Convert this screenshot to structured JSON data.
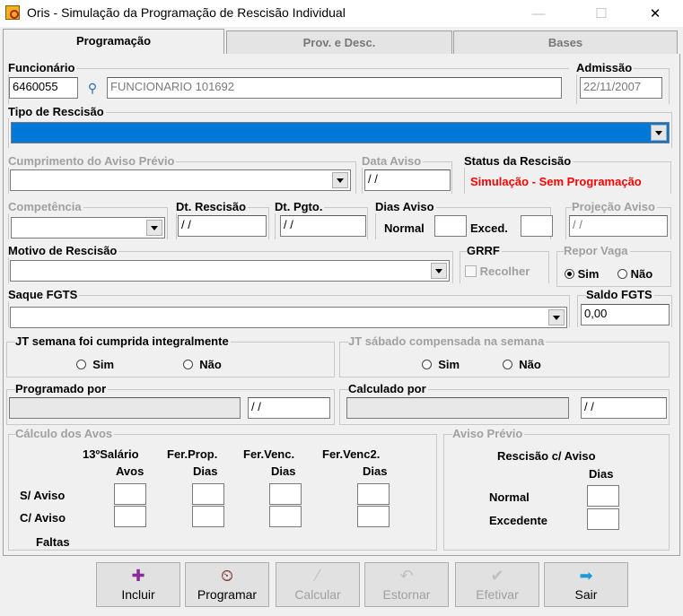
{
  "window": {
    "title": "Oris - Simulação da Programação de Rescisão Individual",
    "minimize": "—",
    "maximize": "☐",
    "close": "✕"
  },
  "tabs": [
    {
      "label": "Programação"
    },
    {
      "label": "Prov. e Desc."
    },
    {
      "label": "Bases"
    }
  ],
  "funcionario": {
    "label": "Funcionário",
    "code": "6460055",
    "name": "FUNCIONARIO 101692",
    "icon": "search-person-icon"
  },
  "admissao": {
    "label": "Admissão",
    "value": "22/11/2007"
  },
  "tipo_rescisao": {
    "label": "Tipo de Rescisão",
    "value": ""
  },
  "cumprimento": {
    "label": "Cumprimento do Aviso Prévio",
    "value": ""
  },
  "data_aviso": {
    "label": "Data Aviso",
    "value": "/ /"
  },
  "status": {
    "label": "Status da Rescisão",
    "value": "Simulação - Sem Programação",
    "color": "#ff0000"
  },
  "competencia": {
    "label": "Competência",
    "value": ""
  },
  "dt_rescisao": {
    "label": "Dt. Rescisão",
    "value": "/ /"
  },
  "dt_pgto": {
    "label": "Dt. Pgto.",
    "value": "/ /"
  },
  "dias_aviso": {
    "label": "Dias Aviso",
    "normal": "Normal",
    "exced": "Exced."
  },
  "projecao": {
    "label": "Projeção Aviso",
    "value": "/ /"
  },
  "motivo": {
    "label": "Motivo de Rescisão",
    "value": ""
  },
  "grrf": {
    "label": "GRRF",
    "recolher": "Recolher"
  },
  "repor_vaga": {
    "label": "Repor Vaga",
    "sim": "Sim",
    "nao": "Não",
    "selected": "sim"
  },
  "saque": {
    "label": "Saque FGTS",
    "value": ""
  },
  "saldo": {
    "label": "Saldo FGTS",
    "value": "0,00"
  },
  "jt_semana": {
    "label": "JT semana foi cumprida integralmente",
    "sim": "Sim",
    "nao": "Não"
  },
  "jt_sabado": {
    "label": "JT sábado compensada na semana",
    "sim": "Sim",
    "nao": "Não"
  },
  "programado": {
    "label": "Programado por",
    "date": "/ /"
  },
  "calculado": {
    "label": "Calculado por",
    "date": "/ /"
  },
  "avos": {
    "label": "Cálculo dos Avos",
    "col1a": "13ºSalário",
    "col1b": "Avos",
    "col2a": "Fer.Prop.",
    "col2b": "Dias",
    "col3a": "Fer.Venc.",
    "col3b": "Dias",
    "col4a": "Fer.Venc2.",
    "col4b": "Dias",
    "row1": "S/ Aviso",
    "row2": "C/ Aviso",
    "row3": "Faltas"
  },
  "aviso_previo": {
    "label": "Aviso Prévio",
    "head1": "Rescisão c/ Aviso",
    "head2": "Dias",
    "normal": "Normal",
    "excedente": "Excedente"
  },
  "buttons": {
    "incluir": "Incluir",
    "programar": "Programar",
    "calcular": "Calcular",
    "estornar": "Estornar",
    "efetivar": "Efetivar",
    "sair": "Sair"
  }
}
